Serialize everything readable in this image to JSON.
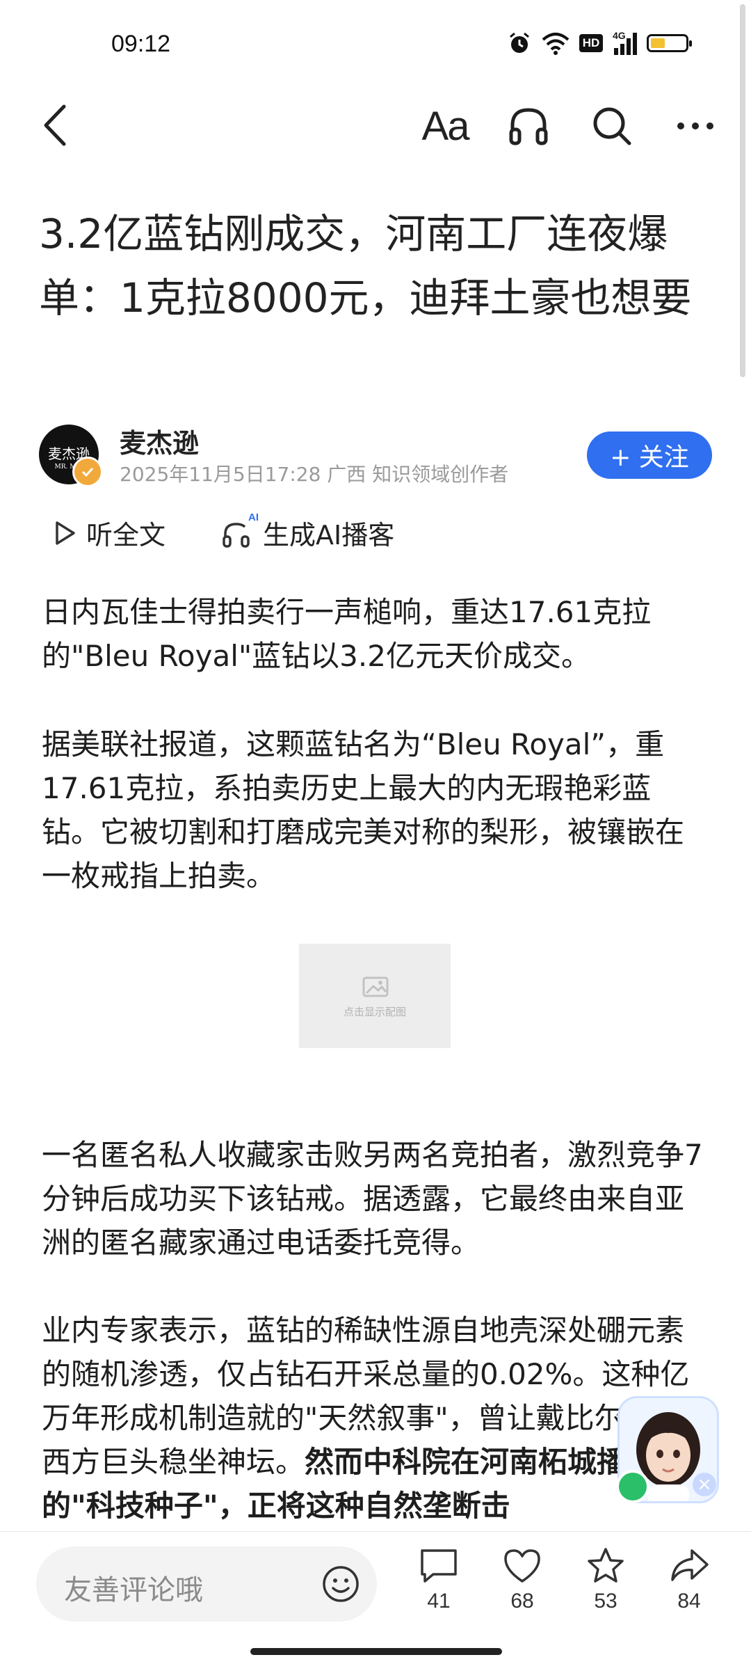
{
  "status": {
    "time": "09:12",
    "network": "4G",
    "hd": "HD"
  },
  "toolbar": {
    "font_label": "Aa"
  },
  "article": {
    "title": "3.2亿蓝钻刚成交，河南工厂连夜爆单：1克拉8000元，迪拜土豪也想要",
    "author": {
      "avatar_text": "麦杰逊",
      "avatar_sub": "MR. MAI",
      "name": "麦杰逊",
      "meta": "2025年11月5日17:28 广西 知识领域创作者",
      "follow_label": "+ 关注"
    },
    "listen_label": "听全文",
    "podcast_label": "生成AI播客",
    "podcast_badge": "AI",
    "paragraphs": [
      "日内瓦佳士得拍卖行一声槌响，重达17.61克拉的\"Bleu Royal\"蓝钻以3.2亿元天价成交。",
      "据美联社报道，这颗蓝钻名为“Bleu Royal”，重17.61克拉，系拍卖历史上最大的内无瑕艳彩蓝钻。它被切割和打磨成完美对称的梨形，被镶嵌在一枚戒指上拍卖。",
      "一名匿名私人收藏家击败另两名竞拍者，激烈竞争7分钟后成功买下该钻戒。据透露，它最终由来自亚洲的匿名藏家通过电话委托竞得。"
    ],
    "para4_normal": "业内专家表示，蓝钻的稀缺性源自地壳深处硼元素的随机渗透，仅占钻石开采总量的0.02%。这种亿万年形成机制造就的\"天然叙事\"，曾让戴比尔斯等西方巨头稳坐神坛。",
    "para4_bold": "然而中科院在河南柘城播下的\"科技种子\"，正将这种自然垄断击",
    "image_placeholder": "点击显示配图"
  },
  "bottom": {
    "comment_placeholder": "友善评论哦",
    "comments": "41",
    "likes": "68",
    "favorites": "53",
    "shares": "84"
  }
}
